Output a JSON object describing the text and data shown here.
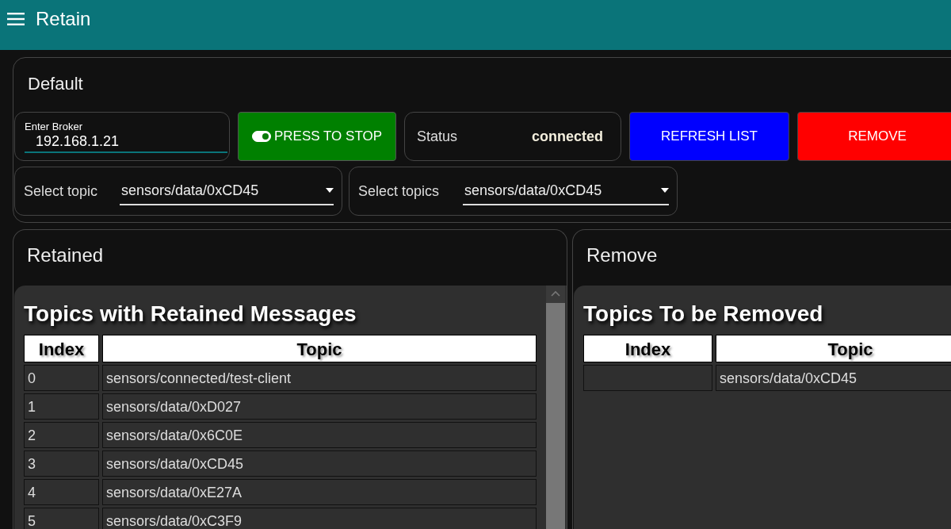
{
  "app_bar": {
    "title": "Retain"
  },
  "default_panel": {
    "title": "Default",
    "broker": {
      "label": "Enter Broker",
      "value": "192.168.1.21"
    },
    "start_button": {
      "label": "PRESS TO STOP",
      "on": true
    },
    "status": {
      "label": "Status",
      "value": "connected"
    },
    "refresh_button": {
      "label": "REFRESH LIST"
    },
    "remove_button": {
      "label": "REMOVE"
    },
    "selects": [
      {
        "label": "Select topic",
        "value": "sensors/data/0xCD45"
      },
      {
        "label": "Select topics",
        "value": "sensors/data/0xCD45"
      }
    ]
  },
  "retained_panel": {
    "title": "Retained",
    "heading": "Topics with Retained Messages",
    "columns": [
      "Index",
      "Topic"
    ],
    "rows": [
      {
        "index": "0",
        "topic": "sensors/connected/test-client"
      },
      {
        "index": "1",
        "topic": "sensors/data/0xD027"
      },
      {
        "index": "2",
        "topic": "sensors/data/0x6C0E"
      },
      {
        "index": "3",
        "topic": "sensors/data/0xCD45"
      },
      {
        "index": "4",
        "topic": "sensors/data/0xE27A"
      },
      {
        "index": "5",
        "topic": "sensors/data/0xC3F9"
      }
    ]
  },
  "remove_panel": {
    "title": "Remove",
    "heading": "Topics To be Removed",
    "columns": [
      "Index",
      "Topic"
    ],
    "rows": [
      {
        "topic": "sensors/data/0xCD45"
      }
    ]
  }
}
